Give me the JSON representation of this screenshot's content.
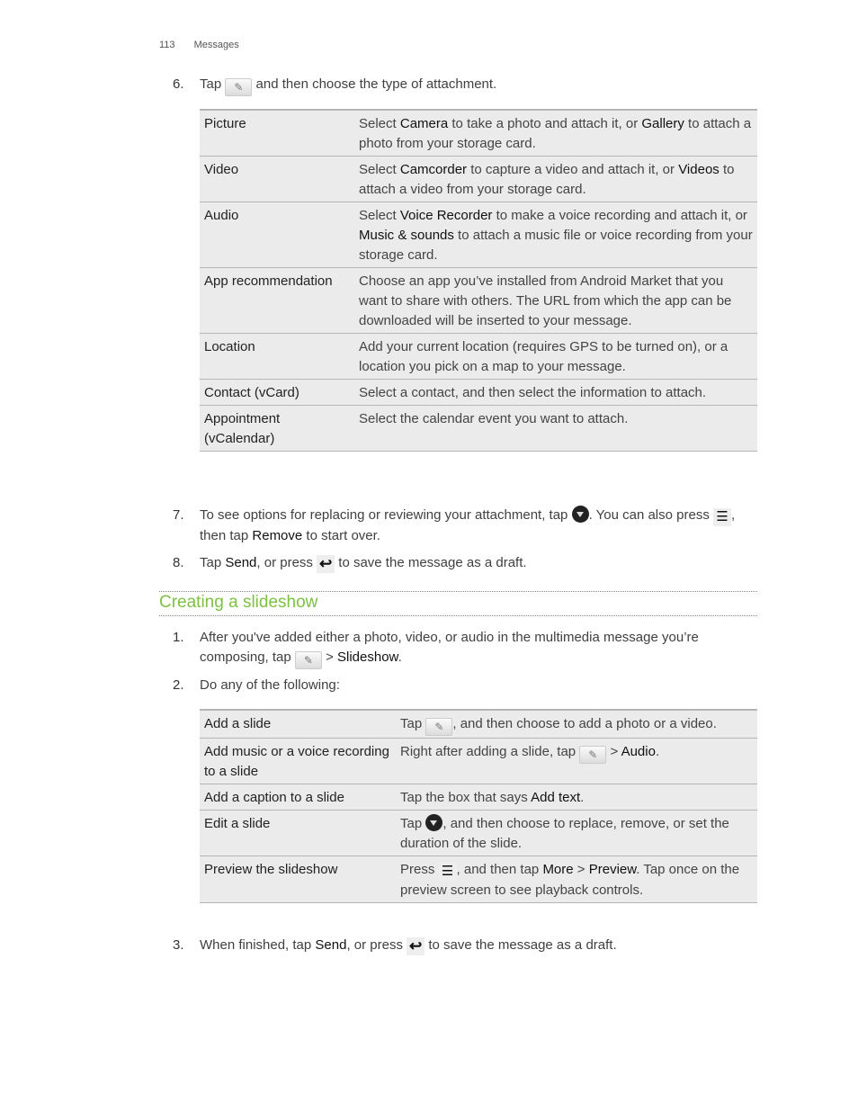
{
  "header": {
    "page_number": "113",
    "section": "Messages"
  },
  "step6": {
    "num": "6.",
    "pre": "Tap",
    "post": "and then choose the type of attachment."
  },
  "attach_table": [
    {
      "type": "Picture",
      "d": [
        "Select ",
        "Camera",
        " to take a photo and attach it, or ",
        "Gallery",
        " to attach a photo from your storage card."
      ]
    },
    {
      "type": "Video",
      "d": [
        "Select ",
        "Camcorder",
        " to capture a video and attach it, or ",
        "Videos",
        " to attach a video from your storage card."
      ]
    },
    {
      "type": "Audio",
      "d": [
        "Select ",
        "Voice Recorder",
        " to make a voice recording and attach it, or ",
        "Music & sounds",
        " to attach a music file or voice recording from your storage card."
      ]
    },
    {
      "type": "App recommendation",
      "d": [
        "Choose an app you’ve installed from Android Market that you want to share with others. The URL from which the app can be downloaded will be inserted to your message."
      ]
    },
    {
      "type": "Location",
      "d": [
        "Add your current location (requires GPS to be turned on), or a location you pick on a map to your message."
      ]
    },
    {
      "type": "Contact (vCard)",
      "d": [
        "Select a contact, and then select the information to attach."
      ]
    },
    {
      "type": "Appointment (vCalendar)",
      "d": [
        "Select the calendar event you want to attach."
      ]
    }
  ],
  "step7": {
    "num": "7.",
    "a": "To see options for replacing or reviewing your attachment, tap",
    "b": ". You can also press",
    "c": ", then tap",
    "remove": "Remove",
    "d": "to start over."
  },
  "step8": {
    "num": "8.",
    "a": "Tap",
    "send": "Send",
    "b": ", or press",
    "c": "to save the message as a draft."
  },
  "section_title": "Creating a slideshow",
  "s1": {
    "num": "1.",
    "a": "After you've added either a photo, video, or audio in the multimedia message you’re composing, tap",
    "b": ">",
    "slideshow": "Slideshow",
    "c": "."
  },
  "s2": {
    "num": "2.",
    "text": "Do any of the following:"
  },
  "slide_table": {
    "r1": {
      "k": "Add a slide",
      "a": "Tap",
      "b": ", and then choose to add a photo or a video."
    },
    "r2": {
      "k": "Add music or a voice recording to a slide",
      "a": "Right after adding a slide, tap",
      "b": ">",
      "audio": "Audio",
      "c": "."
    },
    "r3": {
      "k": "Add a caption to a slide",
      "a": "Tap the box that says",
      "addtext": "Add text",
      "c": "."
    },
    "r4": {
      "k": "Edit a slide",
      "a": "Tap",
      "b": ", and then choose to replace, remove, or set the duration of the slide."
    },
    "r5": {
      "k": "Preview the slideshow",
      "a": "Press",
      "b": ", and then tap",
      "more": "More",
      "gt": ">",
      "preview": "Preview",
      "c": ". Tap once on the preview screen to see playback controls."
    }
  },
  "s3": {
    "num": "3.",
    "a": "When finished, tap",
    "send": "Send",
    "b": ", or press",
    "c": "to save the message as a draft."
  },
  "icons": {
    "clip": "✎",
    "menu": "☰",
    "back": "↩"
  }
}
